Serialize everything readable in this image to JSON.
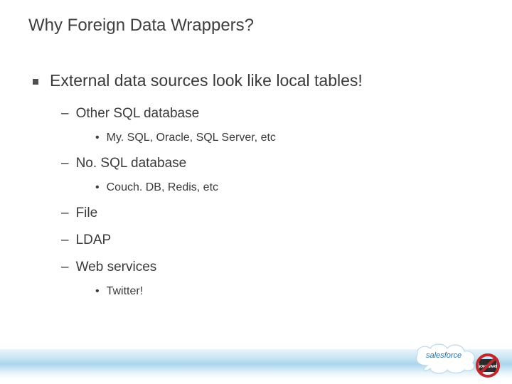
{
  "title": "Why Foreign Data Wrappers?",
  "b1": "External data sources look like local tables!",
  "b1_1": "Other SQL database",
  "b1_1_1": "My. SQL, Oracle, SQL Server, etc",
  "b1_2": "No. SQL database",
  "b1_2_1": "Couch. DB, Redis, etc",
  "b1_3": "File",
  "b1_4": "LDAP",
  "b1_5": "Web services",
  "b1_5_1": "Twitter!",
  "logo_sales": "sales",
  "logo_force": "force",
  "logo_badge": "SOFTWARE"
}
